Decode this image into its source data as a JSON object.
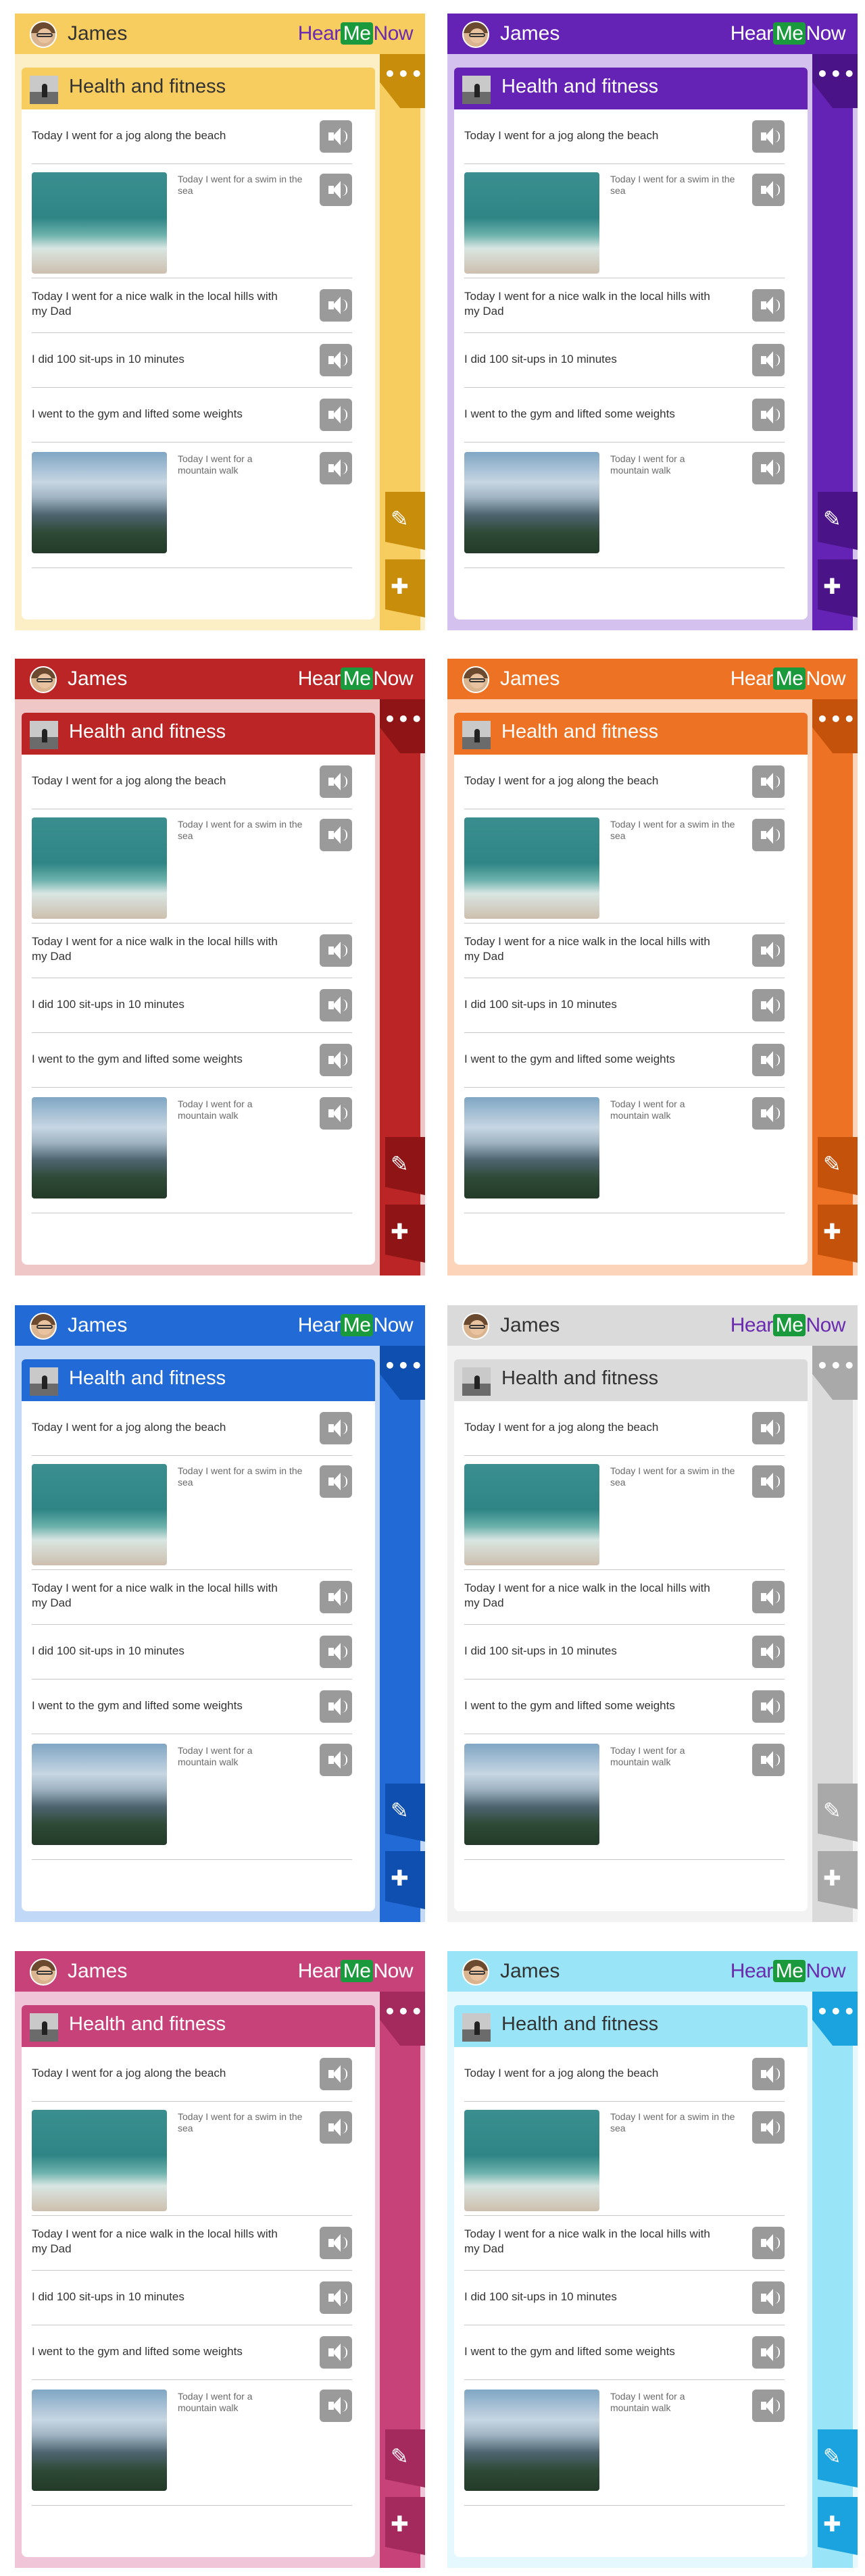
{
  "cards": [
    {
      "theme": "yellow",
      "main": "#f8cd5f",
      "dark": "#c98d0c",
      "light": "#fdefc5",
      "head": "#333333",
      "brand1": "#6a2bb0",
      "brand3": "#6a2bb0"
    },
    {
      "theme": "purple",
      "main": "#6523b5",
      "dark": "#4a1488",
      "light": "#d5c1ee",
      "head": "#ffffff",
      "brand1": "#ffffff",
      "brand3": "#ffffff"
    },
    {
      "theme": "red",
      "main": "#bb2526",
      "dark": "#8e1416",
      "light": "#f0c7c7",
      "head": "#ffffff",
      "brand1": "#ffffff",
      "brand3": "#ffffff"
    },
    {
      "theme": "orange",
      "main": "#ee7223",
      "dark": "#c4520a",
      "light": "#fbd4b9",
      "head": "#ffffff",
      "brand1": "#ffffff",
      "brand3": "#ffffff"
    },
    {
      "theme": "blue",
      "main": "#226ad6",
      "dark": "#0f4fb0",
      "light": "#c2d8f7",
      "head": "#ffffff",
      "brand1": "#ffffff",
      "brand3": "#ffffff"
    },
    {
      "theme": "grey",
      "main": "#dadada",
      "dark": "#a9a9a9",
      "light": "#f2f2f2",
      "head": "#333333",
      "brand1": "#6a2bb0",
      "brand3": "#6a2bb0"
    },
    {
      "theme": "pink",
      "main": "#c8427a",
      "dark": "#a42a5e",
      "light": "#efc5d7",
      "head": "#ffffff",
      "brand1": "#ffffff",
      "brand3": "#ffffff"
    },
    {
      "theme": "cyan",
      "main": "#99e5f7",
      "dark": "#1aa3df",
      "light": "#e4f8fd",
      "head": "#333333",
      "brand1": "#6a2bb0",
      "brand3": "#6a2bb0"
    }
  ],
  "header": {
    "username": "James",
    "brand_part1": "Hear",
    "brand_part2": "Me",
    "brand_part3": "Now"
  },
  "section_title": "Health and fitness",
  "icons": {
    "more": "more-icon",
    "edit": "pencil-icon",
    "add": "plus-icon",
    "speaker": "speaker-icon"
  },
  "entries": [
    {
      "text": "Today I went for a jog along the beach"
    },
    {
      "caption": "Today I went for a swim in the sea"
    },
    {
      "text": "Today I went for a nice walk in the local hills with my Dad"
    },
    {
      "text": "I did 100 sit-ups in 10 minutes"
    },
    {
      "text": "I went to the gym and lifted some weights"
    },
    {
      "caption": "Today I went for a mountain walk"
    }
  ]
}
